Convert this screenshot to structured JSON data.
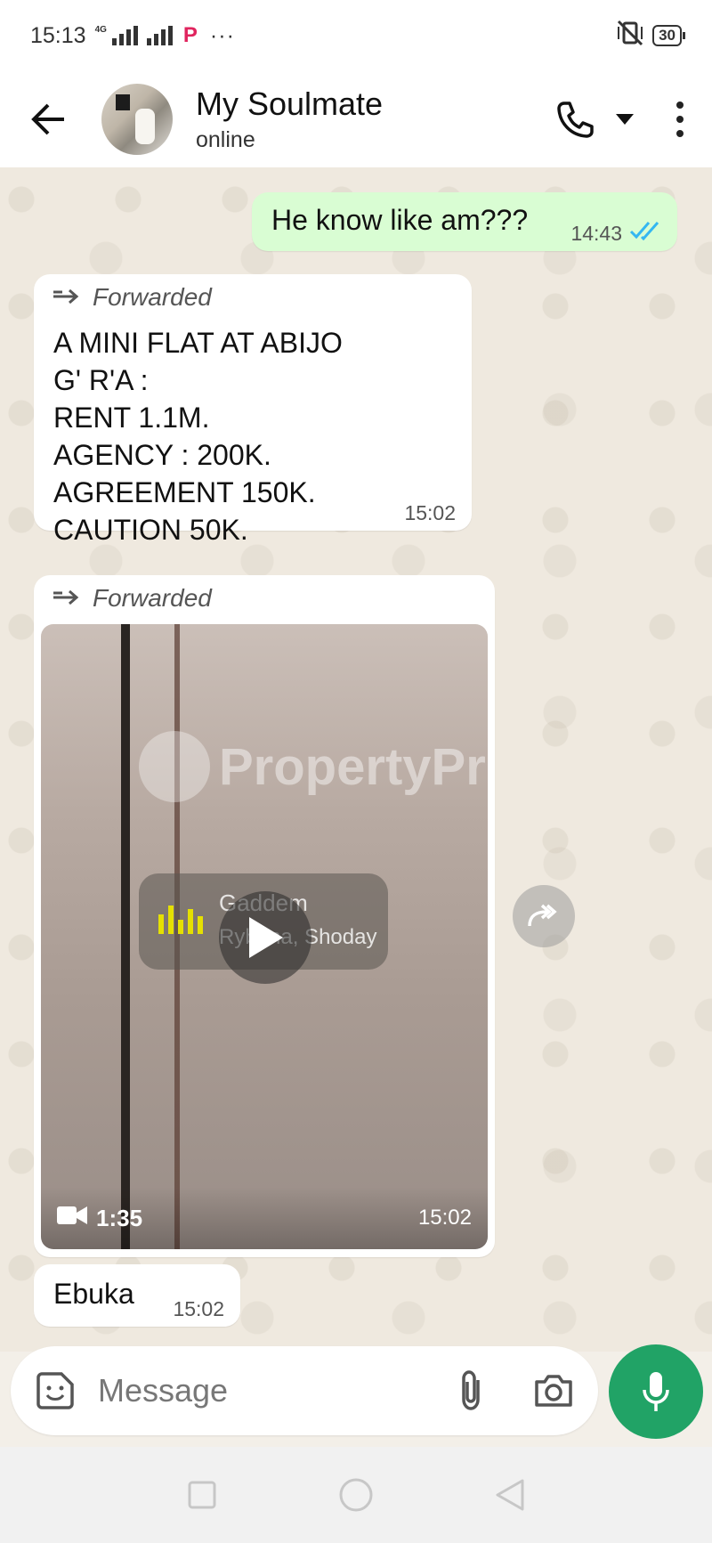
{
  "status_bar": {
    "time": "15:13",
    "network_label": "4G",
    "extra": "···",
    "battery": "30"
  },
  "header": {
    "contact_name": "My Soulmate",
    "contact_status": "online"
  },
  "messages": [
    {
      "direction": "outgoing",
      "text": "He know like am???",
      "time": "14:43",
      "status": "read"
    },
    {
      "direction": "incoming",
      "forwarded_label": "Forwarded",
      "lines": [
        "A MINI FLAT AT ABIJO",
        "G' R'A :",
        "RENT 1.1M.",
        "AGENCY : 200K.",
        "AGREEMENT 150K.",
        "CAUTION 50K."
      ],
      "time": "15:02"
    },
    {
      "direction": "incoming",
      "type": "video",
      "forwarded_label": "Forwarded",
      "watermark": "PropertyPro",
      "overlay_song": "Gaddem",
      "overlay_artist": "Rybena, Shoday",
      "duration": "1:35",
      "time": "15:02"
    },
    {
      "direction": "incoming",
      "text": "Ebuka",
      "time": "15:02"
    }
  ],
  "composer": {
    "placeholder": "Message"
  },
  "colors": {
    "outgoing_bubble": "#d9fdd3",
    "incoming_bubble": "#ffffff",
    "accent_green": "#21a366",
    "read_ticks": "#34b7f1"
  }
}
